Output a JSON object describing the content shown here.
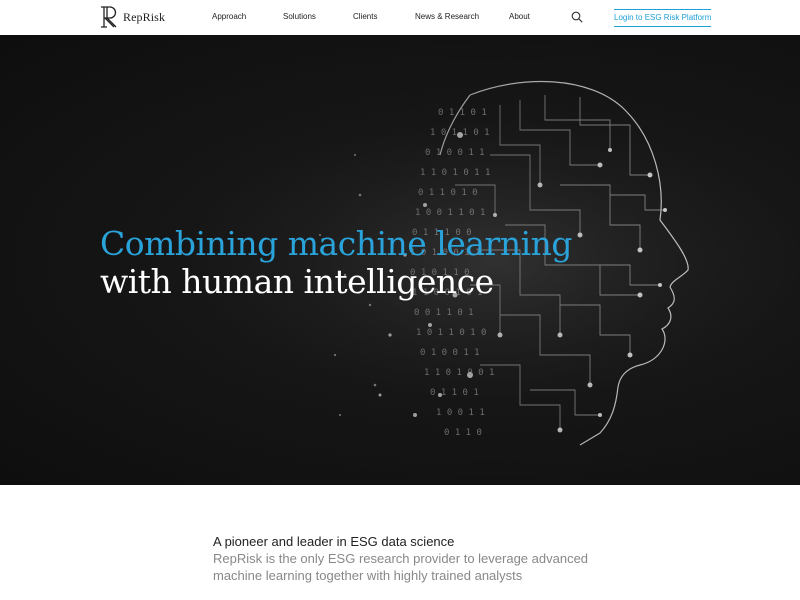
{
  "header": {
    "logo_text": "RepRisk",
    "nav": [
      "Approach",
      "Solutions",
      "Clients",
      "News & Research",
      "About"
    ],
    "login_label": "Login to ESG Risk Platform",
    "search_icon": "search-icon"
  },
  "hero": {
    "headline_line1": "Combining machine learning",
    "headline_line2": "with human intelligence",
    "illustration": "circuit-board-human-head"
  },
  "intro": {
    "title": "A pioneer and leader in ESG data science",
    "body": "RepRisk is the only ESG research provider to leverage advanced machine learning together with highly trained analysts"
  },
  "colors": {
    "accent": "#1ea0d8",
    "hero_background": "#161616",
    "headline_white": "#ffffff",
    "body_gray": "#888888"
  }
}
